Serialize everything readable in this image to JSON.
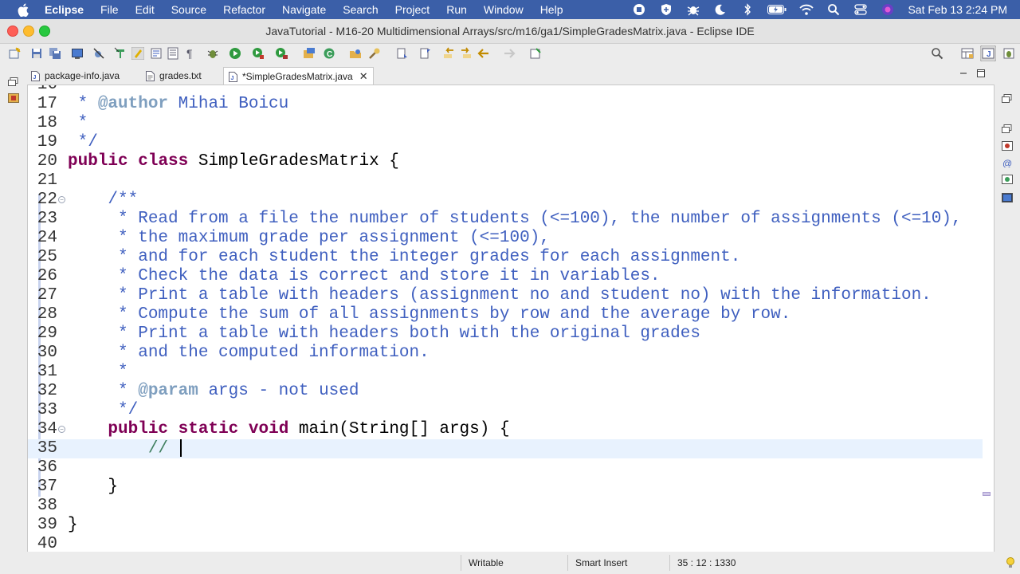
{
  "menubar": {
    "app_name": "Eclipse",
    "items": [
      "File",
      "Edit",
      "Source",
      "Refactor",
      "Navigate",
      "Search",
      "Project",
      "Run",
      "Window",
      "Help"
    ],
    "clock": "Sat Feb 13  2:24 PM"
  },
  "window": {
    "title": "JavaTutorial - M16-20 Multidimensional Arrays/src/m16/ga1/SimpleGradesMatrix.java - Eclipse IDE"
  },
  "tabs": [
    {
      "label": "package-info.java",
      "active": false
    },
    {
      "label": "grades.txt",
      "active": false
    },
    {
      "label": "*SimpleGradesMatrix.java",
      "active": true
    }
  ],
  "editor": {
    "partial_line_number": "16",
    "current_line": 35,
    "lines": [
      {
        "n": "17",
        "text": " * @author Mihai Boicu"
      },
      {
        "n": "18",
        "text": " *"
      },
      {
        "n": "19",
        "text": " */"
      },
      {
        "n": "20",
        "text": "public class SimpleGradesMatrix {"
      },
      {
        "n": "21",
        "text": ""
      },
      {
        "n": "22",
        "text": "    /**"
      },
      {
        "n": "23",
        "text": "     * Read from a file the number of students (<=100), the number of assignments (<=10),"
      },
      {
        "n": "24",
        "text": "     * the maximum grade per assignment (<=100),"
      },
      {
        "n": "25",
        "text": "     * and for each student the integer grades for each assignment."
      },
      {
        "n": "26",
        "text": "     * Check the data is correct and store it in variables."
      },
      {
        "n": "27",
        "text": "     * Print a table with headers (assignment no and student no) with the information."
      },
      {
        "n": "28",
        "text": "     * Compute the sum of all assignments by row and the average by row."
      },
      {
        "n": "29",
        "text": "     * Print a table with headers both with the original grades"
      },
      {
        "n": "30",
        "text": "     * and the computed information."
      },
      {
        "n": "31",
        "text": "     *"
      },
      {
        "n": "32",
        "text": "     * @param args - not used"
      },
      {
        "n": "33",
        "text": "     */"
      },
      {
        "n": "34",
        "text": "    public static void main(String[] args) {"
      },
      {
        "n": "35",
        "text": "        // "
      },
      {
        "n": "36",
        "text": ""
      },
      {
        "n": "37",
        "text": "    }"
      },
      {
        "n": "38",
        "text": ""
      },
      {
        "n": "39",
        "text": "}"
      },
      {
        "n": "40",
        "text": ""
      }
    ]
  },
  "status": {
    "writable": "Writable",
    "insert_mode": "Smart Insert",
    "position": "35 : 12 : 1330"
  },
  "colors": {
    "menubar_bg": "#3b5fa8",
    "keyword": "#7f0055",
    "javadoc": "#3f5fbf",
    "javadoc_tag": "#7f9fbf",
    "comment": "#3f7f5f",
    "current_line": "#e8f2fe"
  },
  "icons": {
    "menubar_status": [
      "screen-record-icon",
      "vpn-icon",
      "bug-icon",
      "moon-icon",
      "bluetooth-icon",
      "battery-icon",
      "wifi-icon",
      "spotlight-search-icon",
      "control-center-icon",
      "siri-icon"
    ]
  }
}
